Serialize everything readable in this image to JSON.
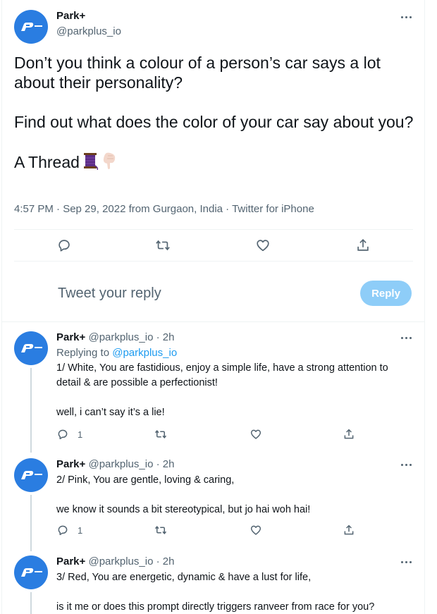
{
  "main_tweet": {
    "name": "Park+",
    "handle": "@parkplus_io",
    "text_lines": [
      "Don’t you think a colour of a person’s car says a lot about their personality?",
      "Find out what does the color of your car say about you?",
      "A Thread"
    ],
    "timestamp": "4:57 PM · Sep 29, 2022 from Gurgaon, India · Twitter for iPhone",
    "actions": [
      "reply-icon",
      "retweet-icon",
      "like-icon",
      "share-icon"
    ]
  },
  "composer": {
    "placeholder": "Tweet your reply",
    "button_label": "Reply"
  },
  "replies": [
    {
      "name": "Park+",
      "handle_time": "@parkplus_io · 2h",
      "replying_prefix": "Replying to ",
      "replying_to": "@parkplus_io",
      "paragraphs": [
        "1/ White, You are fastidious, enjoy a simple life, have a strong attention to detail & are possible a perfectionist!",
        "well, i can’t say it’s a lie!"
      ],
      "reply_count": "1"
    },
    {
      "name": "Park+",
      "handle_time": "@parkplus_io · 2h",
      "paragraphs": [
        "2/ Pink, You are gentle, loving & caring,",
        "we know it sounds a bit stereotypical, but jo hai woh hai!"
      ],
      "reply_count": "1"
    },
    {
      "name": "Park+",
      "handle_time": "@parkplus_io · 2h",
      "paragraphs": [
        "3/ Red, You are energetic, dynamic & have a lust for life,",
        "is it me or does this prompt directly triggers ranveer from race for you?"
      ]
    }
  ],
  "colors": {
    "brand_avatar": "#2a7de1",
    "link": "#1d9bf0",
    "reply_button_disabled": "#8ecdf8",
    "secondary_text": "#536471"
  }
}
